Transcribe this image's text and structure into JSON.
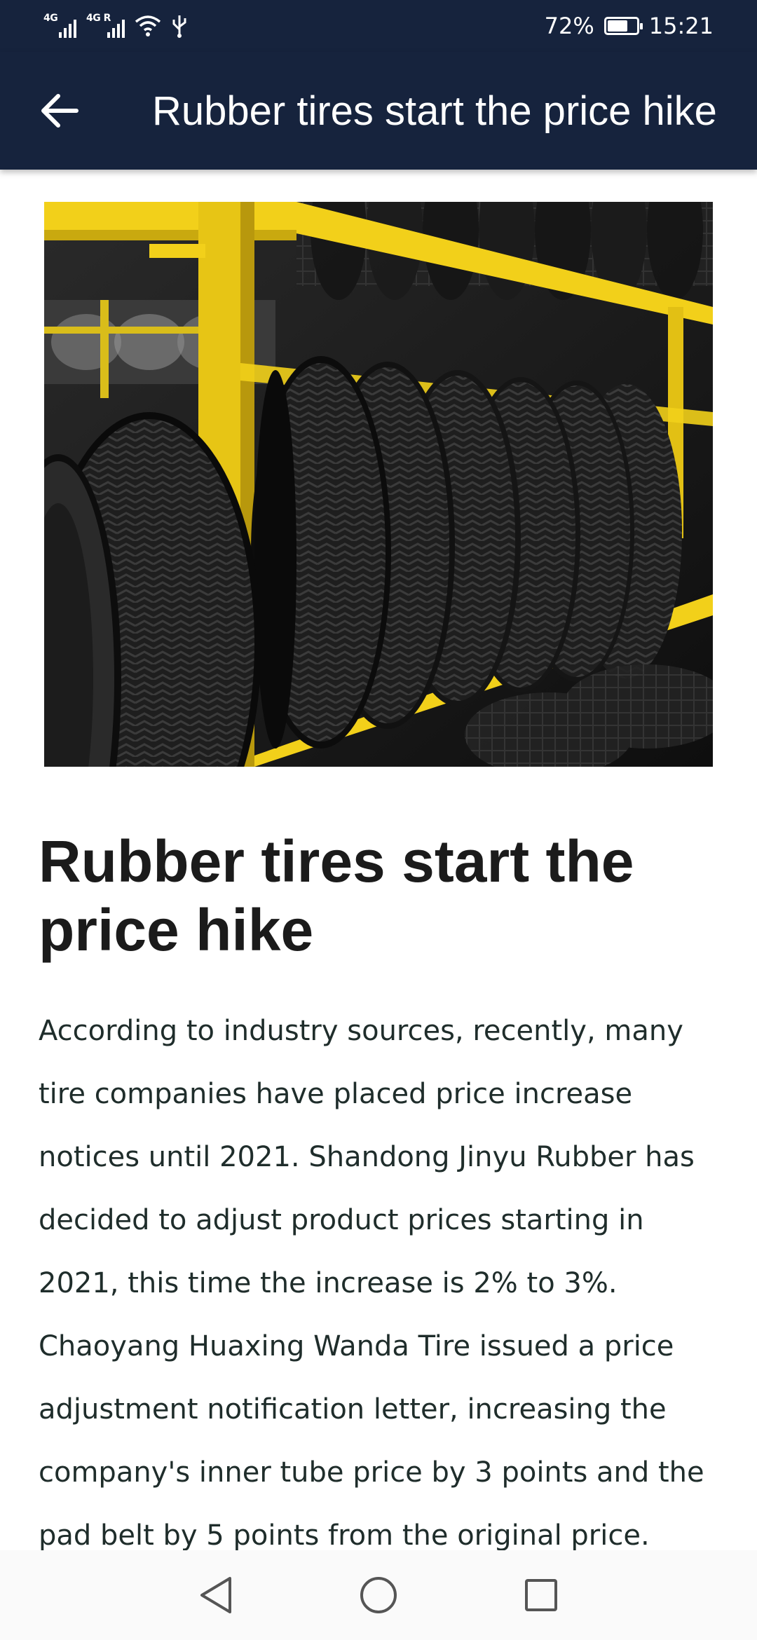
{
  "status_bar": {
    "network_1": "4G",
    "network_2": "4G R",
    "battery_percent": "72%",
    "time": "15:21",
    "battery_level": 0.72
  },
  "app_bar": {
    "title": "Rubber tires start the price hike",
    "back_icon": "arrow-left-icon"
  },
  "hero_image": {
    "subject": "tire rack image"
  },
  "article": {
    "title": "Rubber tires start the price hike",
    "body": "According to industry sources, recently, many tire companies have placed price increase notices until 2021. Shandong Jinyu Rubber has decided to adjust product prices starting in 2021, this time the increase is 2% to 3%. Chaoyang Huaxing Wanda Tire issued a price adjustment notification letter, increasing the company's inner tube price by 3 points and the pad belt by 5 points from the original price."
  },
  "nav_bar": {
    "back": "triangle-back-icon",
    "home": "circle-home-icon",
    "recents": "square-recents-icon"
  },
  "colors": {
    "header_bg": "#16233d",
    "rack_yellow": "#f2d01a",
    "text": "#1f2d2b"
  }
}
